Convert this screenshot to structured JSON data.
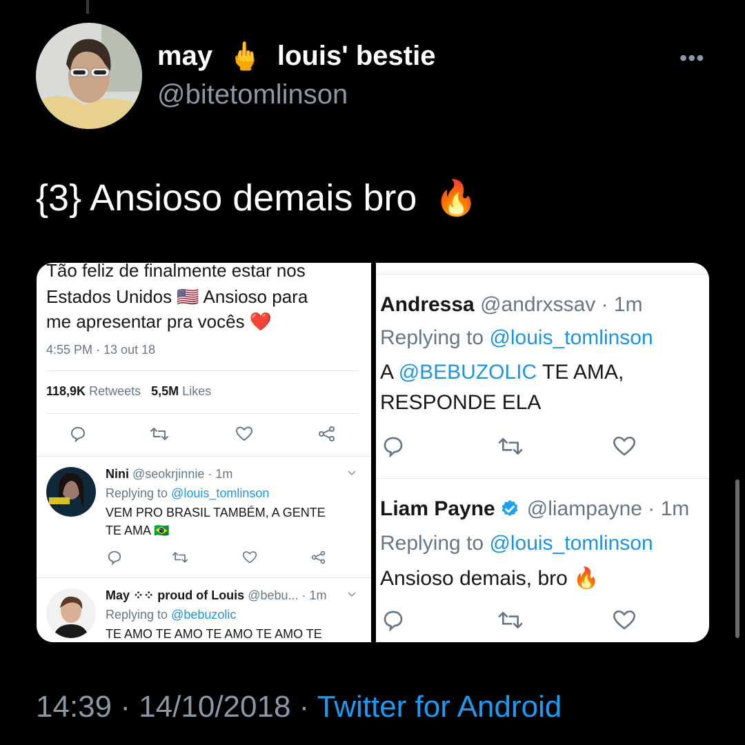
{
  "author": {
    "name_part1": "may",
    "name_emoji": "🖕",
    "name_part2": "louis' bestie",
    "handle": "@bitetomlinson"
  },
  "tweet": {
    "text": "{3} Ansioso demais bro",
    "emoji": "🔥"
  },
  "left_panel": {
    "line1": "Tão feliz de finalmente estar nos",
    "line2_a": "Estados Unidos",
    "line2_flag": "🇺🇸",
    "line2_b": "Ansioso para",
    "line3": "me apresentar pra vocês",
    "line3_emoji": "❤️",
    "timestamp": "4:55 PM · 13 out 18",
    "retweets_count": "118,9K",
    "retweets_label": "Retweets",
    "likes_count": "5,5M",
    "likes_label": "Likes",
    "reply1": {
      "name": "Nini",
      "handle": "@seokrjinnie · 1m",
      "replying_prefix": "Replying to",
      "replying_to": "@louis_tomlinson",
      "line1": "VEM PRO BRASIL TAMBÉM, A GENTE",
      "line2": "TE AMA",
      "line2_flag": "🇧🇷",
      "avatar_text": "RADIO"
    },
    "reply2": {
      "name": "May",
      "name_emoji": "⁘⁘",
      "name_rest": "proud of Louis",
      "handle": "@bebu... · 1m",
      "replying_prefix": "Replying to",
      "replying_to": "@bebuzolic",
      "line1": "TE AMO TE AMO TE AMO TE AMO TE"
    }
  },
  "right_panel": {
    "reply1": {
      "name": "Andressa",
      "handle": "@andrxssav · 1m",
      "replying_prefix": "Replying to",
      "replying_to": "@louis_tomlinson",
      "text_a": "A",
      "mention": "@BEBUZOLIC",
      "text_b": "TE AMA,",
      "line2": "RESPONDE ELA"
    },
    "reply2": {
      "name": "Liam Payne",
      "handle": "@liampayne · 1m",
      "replying_prefix": "Replying to",
      "replying_to": "@louis_tomlinson",
      "text": "Ansioso demais, bro",
      "emoji": "🔥"
    }
  },
  "footer": {
    "time_date": "14:39 · 14/10/2018 ·",
    "source": "Twitter for Android"
  },
  "colors": {
    "background": "#000000",
    "link_blue": "#1b95e0",
    "secondary_text": "#8b98a5",
    "verified": "#1da1f2"
  }
}
